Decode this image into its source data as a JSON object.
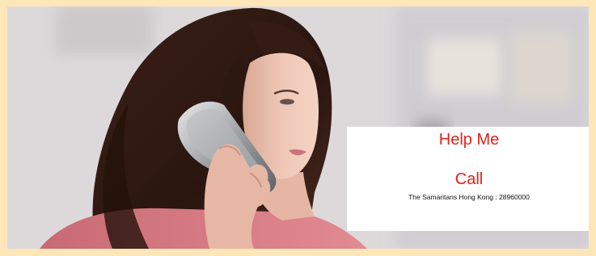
{
  "frame": {
    "background": "#fde6b8"
  },
  "photo": {
    "subject_icon": "woman-on-phone-photo",
    "card": {
      "title": "Help Me",
      "call_label": "Call",
      "contact_line": "The Samaritans Hong Kong : 28960000",
      "accent_color": "#e2231a"
    }
  }
}
